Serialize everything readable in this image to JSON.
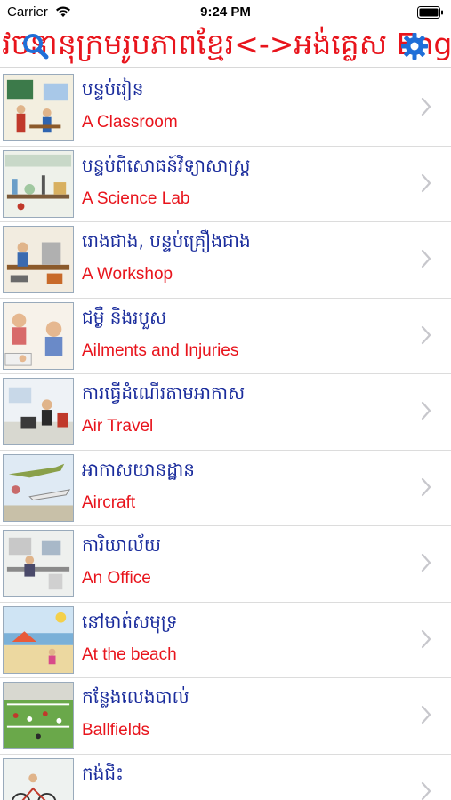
{
  "status_bar": {
    "carrier": "Carrier",
    "time": "9:24 PM"
  },
  "nav": {
    "title": "វចនានុក្រមរូបភាពខ្មែរ<->អង់គ្លេស Eng",
    "search_icon": "search-icon",
    "settings_icon": "gear-icon",
    "accent_color": "#e8141c"
  },
  "items": [
    {
      "km": "បន្ទប់រៀន",
      "en": "A Classroom",
      "thumb": "classroom"
    },
    {
      "km": "បន្ទប់ពិសោធន៍វិទ្យាសាស្ត្រ",
      "en": "A Science Lab",
      "thumb": "lab"
    },
    {
      "km": "រោងជាង, បន្ទប់គ្រឿងជាង",
      "en": "A Workshop",
      "thumb": "workshop"
    },
    {
      "km": "ជម្ងឺ និងរបួស",
      "en": "Ailments and Injuries",
      "thumb": "ailments"
    },
    {
      "km": "ការធ្វើដំណើរតាមអាកាស",
      "en": "Air Travel",
      "thumb": "airtravel"
    },
    {
      "km": "អាកាសយានដ្ឋាន",
      "en": "Aircraft",
      "thumb": "aircraft"
    },
    {
      "km": "ការិយាល័យ",
      "en": "An Office",
      "thumb": "office"
    },
    {
      "km": "នៅមាត់សមុទ្រ",
      "en": "At the beach",
      "thumb": "beach"
    },
    {
      "km": "កន្លែងលេងបាល់",
      "en": "Ballfields",
      "thumb": "ballfields"
    },
    {
      "km": "កង់ជិះ",
      "en": "",
      "thumb": "bikes"
    }
  ],
  "colors": {
    "khmer_text": "#1a2c9c",
    "english_text": "#e8141c",
    "separator": "#dcdcdc"
  }
}
